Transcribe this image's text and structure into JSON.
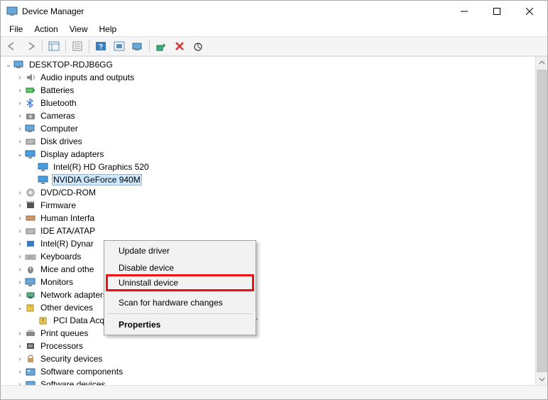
{
  "window": {
    "title": "Device Manager"
  },
  "menu": {
    "file": "File",
    "action": "Action",
    "view": "View",
    "help": "Help"
  },
  "tree": {
    "root": "DESKTOP-RDJB6GG",
    "audio": "Audio inputs and outputs",
    "batteries": "Batteries",
    "bluetooth": "Bluetooth",
    "cameras": "Cameras",
    "computer": "Computer",
    "disk": "Disk drives",
    "display": "Display adapters",
    "intelgfx": "Intel(R) HD Graphics 520",
    "nvidia": "NVIDIA GeForce 940M",
    "dvd": "DVD/CD-ROM",
    "firmware": "Firmware",
    "hid": "Human Interfa",
    "ide": "IDE ATA/ATAP",
    "inteldyn": "Intel(R) Dynar",
    "keyboards": "Keyboards",
    "mice": "Mice and othe",
    "monitors": "Monitors",
    "network": "Network adapters",
    "other": "Other devices",
    "pci": "PCI Data Acquisition and Signal Processing Controller",
    "print": "Print queues",
    "processors": "Processors",
    "security": "Security devices",
    "softcomp": "Software components",
    "softdev": "Software devices"
  },
  "ctx": {
    "update": "Update driver",
    "disable": "Disable device",
    "uninstall": "Uninstall device",
    "scan": "Scan for hardware changes",
    "properties": "Properties"
  },
  "expanders": {
    "open": "⌄",
    "closed": "›"
  }
}
